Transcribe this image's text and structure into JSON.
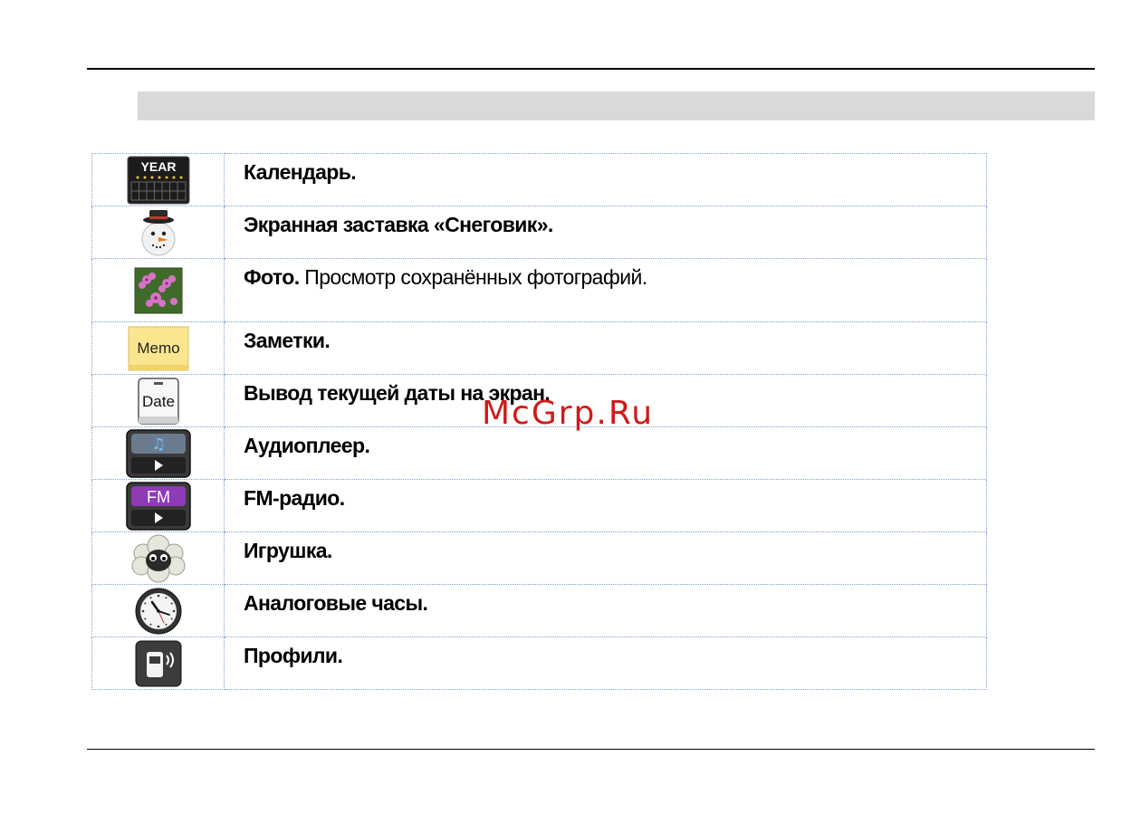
{
  "rows": [
    {
      "icon": "calendar-year-icon",
      "title": "Календарь.",
      "desc": ""
    },
    {
      "icon": "snowman-icon",
      "title": "Экранная заставка «Снеговик».",
      "desc": ""
    },
    {
      "icon": "photo-flowers-icon",
      "title": "Фото.",
      "desc": " Просмотр сохранённых фотографий."
    },
    {
      "icon": "memo-note-icon",
      "title": "Заметки.",
      "desc": ""
    },
    {
      "icon": "date-display-icon",
      "title": "Вывод текущей даты на экран.",
      "desc": ""
    },
    {
      "icon": "audio-player-icon",
      "title": "Аудиоплеер.",
      "desc": ""
    },
    {
      "icon": "fm-radio-icon",
      "title": "FM-радио.",
      "desc": ""
    },
    {
      "icon": "sheep-game-icon",
      "title": "Игрушка.",
      "desc": ""
    },
    {
      "icon": "analog-clock-icon",
      "title": "Аналоговые часы.",
      "desc": ""
    },
    {
      "icon": "profiles-phone-icon",
      "title": "Профили.",
      "desc": ""
    }
  ],
  "icon_labels": {
    "calendar": "YEAR",
    "memo": "Memo",
    "date": "Date",
    "fm": "FM"
  },
  "watermark": "McGrp.Ru"
}
